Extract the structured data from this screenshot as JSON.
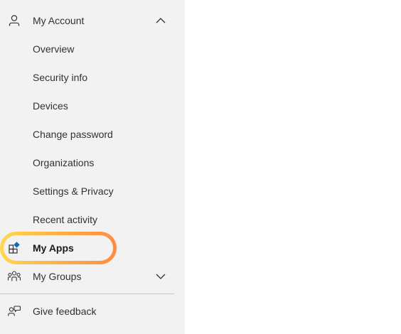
{
  "sidebar": {
    "account": {
      "label": "My Account",
      "icon": "person-icon",
      "expanded": true
    },
    "sub_items": [
      {
        "label": "Overview"
      },
      {
        "label": "Security info"
      },
      {
        "label": "Devices"
      },
      {
        "label": "Change password"
      },
      {
        "label": "Organizations"
      },
      {
        "label": "Settings & Privacy"
      },
      {
        "label": "Recent activity"
      }
    ],
    "my_apps": {
      "label": "My Apps",
      "icon": "apps-icon",
      "selected": true,
      "highlight_colors": [
        "#ffd84d",
        "#ff8c42"
      ]
    },
    "my_groups": {
      "label": "My Groups",
      "icon": "groups-icon",
      "expanded": false
    },
    "feedback": {
      "label": "Give feedback",
      "icon": "feedback-icon"
    }
  },
  "colors": {
    "sidebar_bg": "#f2f2f2",
    "text": "#323130",
    "accent": "#0f6cbd"
  }
}
